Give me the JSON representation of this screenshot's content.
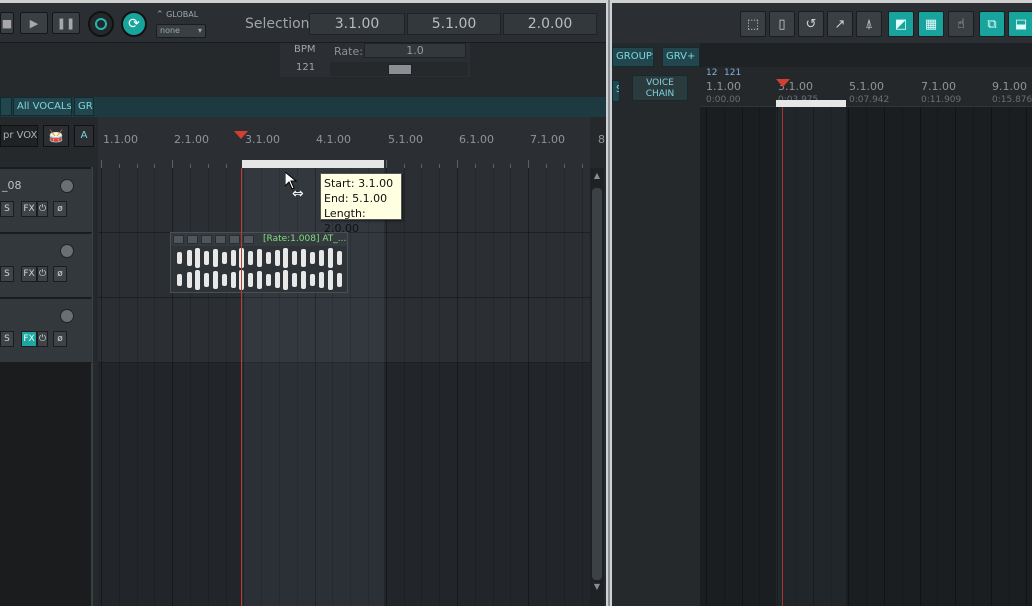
{
  "transport": {
    "global_label": "GLOBAL",
    "global_value": "none",
    "selection_label": "Selection:",
    "selection_start": "3.1.00",
    "selection_end": "5.1.00",
    "selection_length": "2.0.00",
    "bpm_label": "BPM",
    "bpm_value": "121",
    "rate_label": "Rate:",
    "rate_value": "1.0"
  },
  "folders": [
    {
      "label": "All VOCALs"
    },
    {
      "label": "GR"
    }
  ],
  "tcp": {
    "vox_label": "pr VOX",
    "a_label": "A"
  },
  "tracks": [
    {
      "name": "_08",
      "solo": "S",
      "fx": "FX",
      "fx_active": false
    },
    {
      "name": "",
      "solo": "S",
      "fx": "FX",
      "fx_active": false
    },
    {
      "name": "",
      "solo": "S",
      "fx": "FX",
      "fx_active": true
    }
  ],
  "ruler": {
    "labels": [
      "1.1.00",
      "2.1.00",
      "3.1.00",
      "4.1.00",
      "5.1.00",
      "6.1.00",
      "7.1.00",
      "8"
    ]
  },
  "item": {
    "name": "[Rate:1.008] AT_..."
  },
  "tooltip": {
    "start": "Start: 3.1.00",
    "end": "End: 5.1.00",
    "length": "Length: 2.0.00"
  },
  "right": {
    "groups_label": "GROUPS",
    "grv_label": "GRV+",
    "voice_chain": "VOICE CHAIN",
    "s_label": "S",
    "ruler_top_a": "12",
    "ruler_top_b": "121",
    "ruler_labels": [
      "1.1.00",
      "3.1.00",
      "5.1.00",
      "7.1.00",
      "9.1.00"
    ],
    "ruler_times": [
      "0:00.00",
      "0:03.975",
      "0:07.942",
      "0:11.909",
      "0:15.876"
    ]
  },
  "colors": {
    "accent_teal": "#18a39c",
    "play_cursor": "#c23a2e",
    "tooltip_bg": "#ffffe1"
  }
}
